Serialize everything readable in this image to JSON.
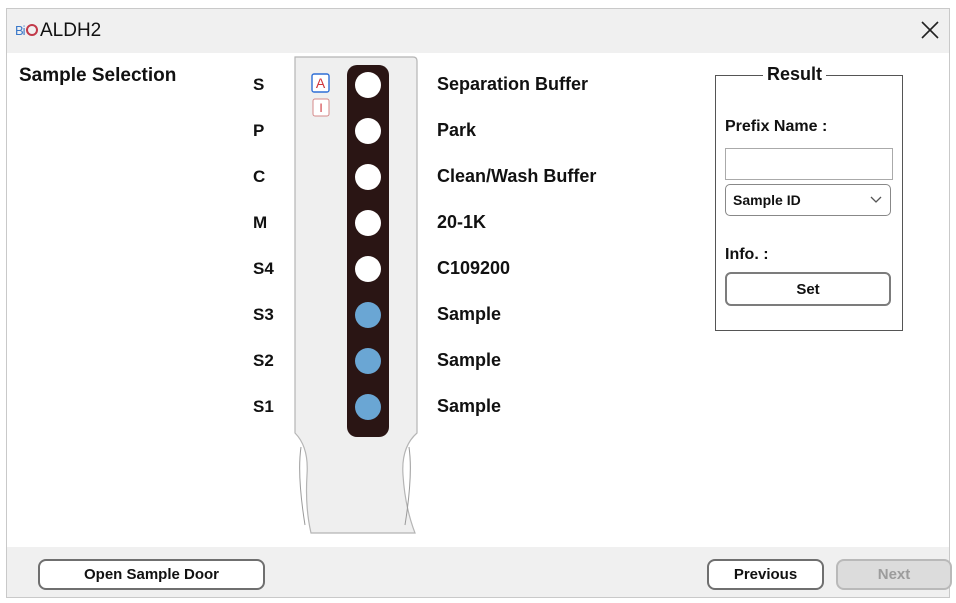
{
  "window": {
    "logo_text": "Bi",
    "title": "ALDH2",
    "close_glyph": "close-icon"
  },
  "main": {
    "heading": "Sample Selection",
    "rows": [
      {
        "label": "S",
        "description": "Separation Buffer",
        "dot": "white"
      },
      {
        "label": "P",
        "description": "Park",
        "dot": "white"
      },
      {
        "label": "C",
        "description": "Clean/Wash Buffer",
        "dot": "white"
      },
      {
        "label": "M",
        "description": "20-1K",
        "dot": "white"
      },
      {
        "label": "S4",
        "description": "C109200",
        "dot": "white"
      },
      {
        "label": "S3",
        "description": "Sample",
        "dot": "blue"
      },
      {
        "label": "S2",
        "description": "Sample",
        "dot": "blue"
      },
      {
        "label": "S1",
        "description": "Sample",
        "dot": "blue"
      }
    ],
    "cartridge_badges": {
      "a": "A",
      "i": "I"
    }
  },
  "result": {
    "legend": "Result",
    "prefix_label": "Prefix Name :",
    "prefix_value": "",
    "id_type_selected": "Sample ID",
    "info_label": "Info. :",
    "set_label": "Set"
  },
  "footer": {
    "open_door_label": "Open Sample Door",
    "previous_label": "Previous",
    "next_label": "Next"
  },
  "colors": {
    "dot_white": "#ffffff",
    "dot_blue": "#6aa6d4",
    "strip": "#2a1514",
    "badge_red": "#d0353b",
    "badge_blue": "#2f6fd6"
  }
}
